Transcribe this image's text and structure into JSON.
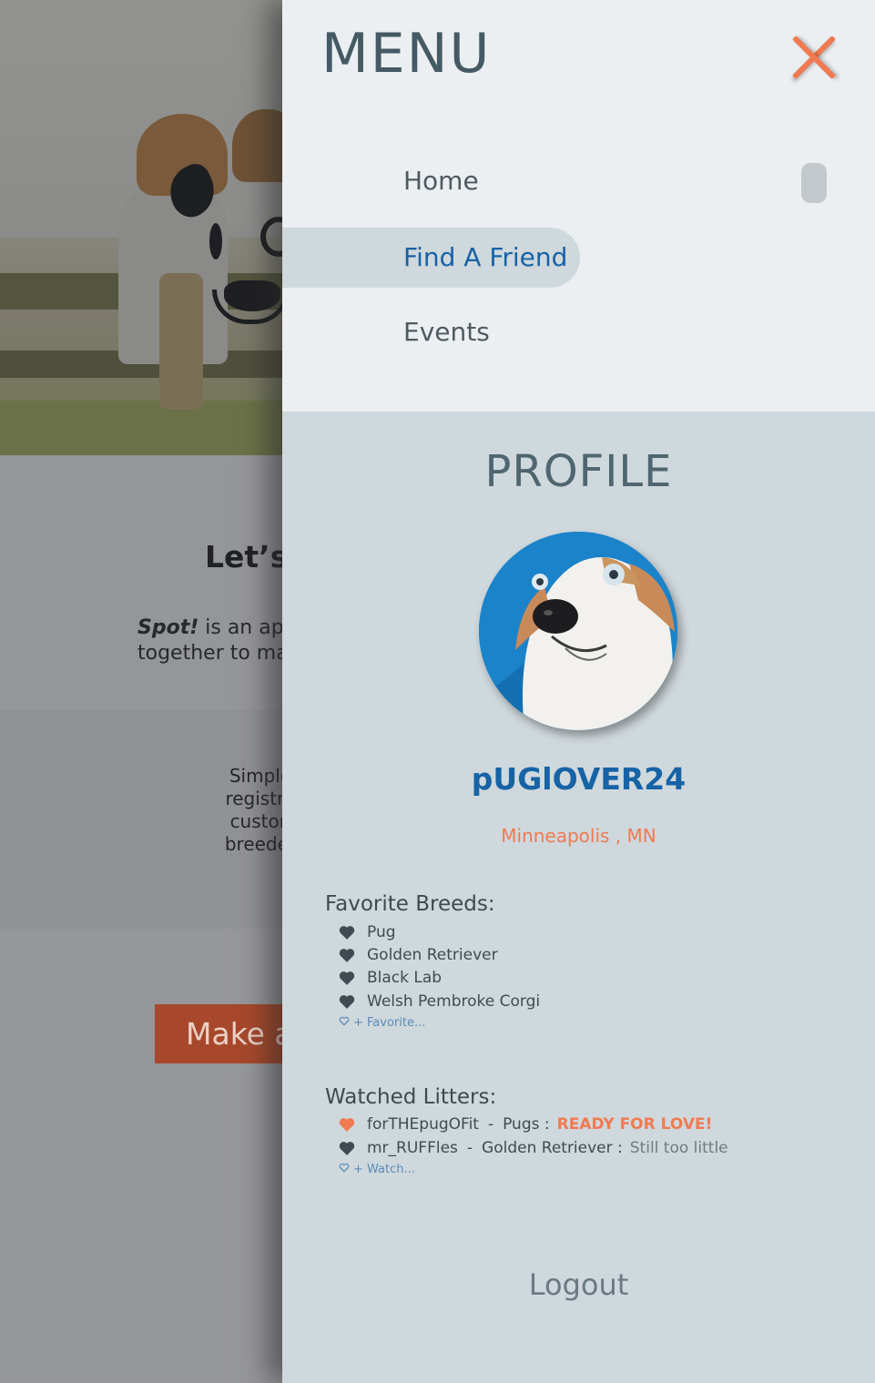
{
  "background": {
    "heading": "Let’s",
    "intro_italic": "Spot!",
    "intro_rest_line1": " is an app",
    "intro_line2": "together to ma",
    "feature_lines": [
      "Simple",
      "registra",
      "custon",
      "breeder"
    ],
    "cta_label": "Make a"
  },
  "menu": {
    "title": "MENU",
    "close_icon": "close-icon",
    "items": [
      {
        "label": "Home",
        "active": false
      },
      {
        "label": "Find A Friend",
        "active": true
      },
      {
        "label": "Events",
        "active": false
      }
    ]
  },
  "profile": {
    "title": "PROFILE",
    "username": "pUGlOVER24",
    "location": "Minneapolis , MN",
    "favorite_breeds_label": "Favorite Breeds:",
    "favorite_breeds": [
      "Pug",
      "Golden Retriever",
      "Black Lab",
      "Welsh Pembroke Corgi"
    ],
    "add_favorite_label": "+ Favorite...",
    "watched_litters_label": "Watched Litters:",
    "watched_litters": [
      {
        "breeder": "forTHEpugOFit",
        "sep": "-",
        "breed": "Pugs :",
        "status": "READY FOR LOVE!",
        "highlight": true
      },
      {
        "breeder": "mr_RUFFles",
        "sep": "-",
        "breed": "Golden Retriever :",
        "status": "Still too little",
        "highlight": false
      }
    ],
    "add_watch_label": "+ Watch...",
    "logout_label": "Logout"
  },
  "colors": {
    "accent_orange": "#f07a52",
    "accent_blue": "#1663a6",
    "drawer_bg": "#cfd8dc",
    "menu_bg": "#eceff1",
    "heart_dark": "#3f4b51"
  }
}
